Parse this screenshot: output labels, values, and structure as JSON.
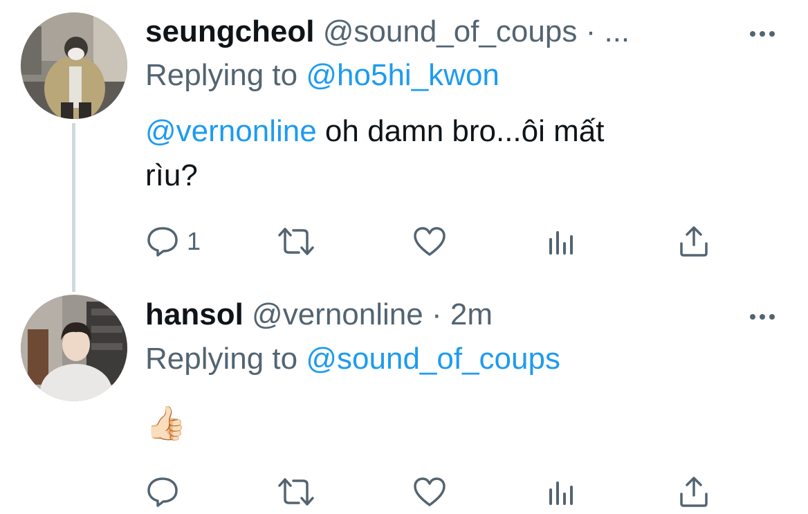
{
  "tweets": [
    {
      "display_name": "seungcheol",
      "handle": "@sound_of_coups",
      "separator": "·",
      "time": "...",
      "replying_label": "Replying to",
      "replying_to": "@ho5hi_kwon",
      "mention": "@vernonline",
      "text_line1": " oh damn bro...ôi mất",
      "text_line2": "rìu?",
      "reply_count": "1",
      "icons": [
        "reply-icon",
        "retweet-icon",
        "like-icon",
        "analytics-icon",
        "share-icon"
      ]
    },
    {
      "display_name": "hansol",
      "handle": "@vernonline",
      "separator": "·",
      "time": "2m",
      "replying_label": "Replying to",
      "replying_to": "@sound_of_coups",
      "text": "👍🏻",
      "icons": [
        "reply-icon",
        "retweet-icon",
        "like-icon",
        "analytics-icon",
        "share-icon"
      ]
    }
  ],
  "colors": {
    "link": "#1d9bf0",
    "secondary_text": "#536471",
    "primary_text": "#0f1419",
    "thread_line": "#cfd9de"
  }
}
